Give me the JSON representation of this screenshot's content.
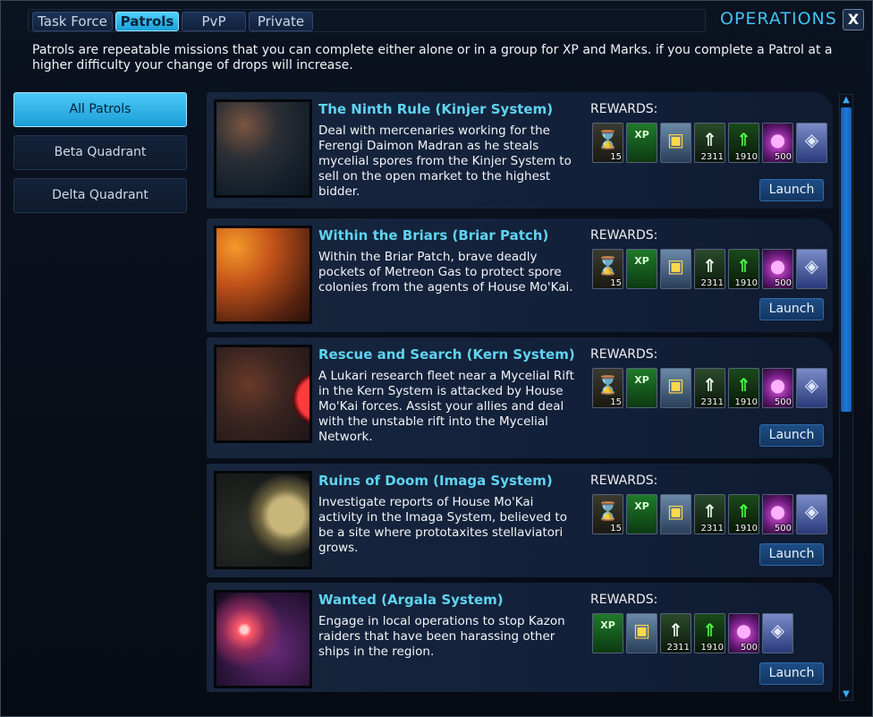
{
  "tabs": [
    "Task Force",
    "Patrols",
    "PvP",
    "Private"
  ],
  "active_tab": "Patrols",
  "window_title": "OPERATIONS",
  "close_label": "X",
  "intro": "Patrols are repeatable missions that you can complete either alone or in a group for XP and Marks. if you complete a Patrol at a higher difficulty your change of drops will increase.",
  "sidebar": {
    "items": [
      {
        "label": "All Patrols",
        "active": true
      },
      {
        "label": "Beta Quadrant",
        "active": false
      },
      {
        "label": "Delta Quadrant",
        "active": false
      }
    ]
  },
  "missions": [
    {
      "title": "The Ninth Rule (Kinjer System)",
      "description": "Deal with mercenaries working for the Ferengi Daimon Madran as he steals mycelial spores from the Kinjer System to sell on the open market to the highest bidder.",
      "rewards_label": "REWARDS:",
      "launch_label": "Launch",
      "rewards": [
        {
          "icon": "hourglass-icon",
          "qty": "15"
        },
        {
          "icon": "xp-2x-icon",
          "qty": ""
        },
        {
          "icon": "lockbox-icon",
          "qty": ""
        },
        {
          "icon": "chevron-up-white-icon",
          "qty": "2311"
        },
        {
          "icon": "chevron-up-green-icon",
          "qty": "1910"
        },
        {
          "icon": "mycelial-pod-icon",
          "qty": "500"
        },
        {
          "icon": "crate-icon",
          "qty": ""
        }
      ]
    },
    {
      "title": "Within the Briars (Briar Patch)",
      "description": "Within the Briar Patch, brave deadly pockets of Metreon Gas to protect spore colonies from the agents of House Mo'Kai.",
      "rewards_label": "REWARDS:",
      "launch_label": "Launch",
      "rewards": [
        {
          "icon": "hourglass-icon",
          "qty": "15"
        },
        {
          "icon": "xp-2x-icon",
          "qty": ""
        },
        {
          "icon": "lockbox-icon",
          "qty": ""
        },
        {
          "icon": "chevron-up-white-icon",
          "qty": "2311"
        },
        {
          "icon": "chevron-up-green-icon",
          "qty": "1910"
        },
        {
          "icon": "mycelial-pod-icon",
          "qty": "500"
        },
        {
          "icon": "crate-icon",
          "qty": ""
        }
      ]
    },
    {
      "title": "Rescue and Search (Kern System)",
      "description": "A Lukari research fleet near a Mycelial Rift in the Kern System is attacked by House Mo'Kai forces. Assist your allies and deal with the unstable rift into the Mycelial Network.",
      "rewards_label": "REWARDS:",
      "launch_label": "Launch",
      "rewards": [
        {
          "icon": "hourglass-icon",
          "qty": "15"
        },
        {
          "icon": "xp-2x-icon",
          "qty": ""
        },
        {
          "icon": "lockbox-icon",
          "qty": ""
        },
        {
          "icon": "chevron-up-white-icon",
          "qty": "2311"
        },
        {
          "icon": "chevron-up-green-icon",
          "qty": "1910"
        },
        {
          "icon": "mycelial-pod-icon",
          "qty": "500"
        },
        {
          "icon": "crate-icon",
          "qty": ""
        }
      ]
    },
    {
      "title": "Ruins of Doom (Imaga System)",
      "description": "Investigate reports of House Mo'Kai activity in the Imaga System, believed to be a site where prototaxites stellaviatori grows.",
      "rewards_label": "REWARDS:",
      "launch_label": "Launch",
      "rewards": [
        {
          "icon": "hourglass-icon",
          "qty": "15"
        },
        {
          "icon": "xp-2x-icon",
          "qty": ""
        },
        {
          "icon": "lockbox-icon",
          "qty": ""
        },
        {
          "icon": "chevron-up-white-icon",
          "qty": "2311"
        },
        {
          "icon": "chevron-up-green-icon",
          "qty": "1910"
        },
        {
          "icon": "mycelial-pod-icon",
          "qty": "500"
        },
        {
          "icon": "crate-icon",
          "qty": ""
        }
      ]
    },
    {
      "title": "Wanted (Argala System)",
      "description": "Engage in local operations to stop Kazon raiders that have been harassing other ships in the region.",
      "rewards_label": "REWARDS:",
      "launch_label": "Launch",
      "rewards": [
        {
          "icon": "xp-2x-icon",
          "qty": ""
        },
        {
          "icon": "lockbox-icon",
          "qty": ""
        },
        {
          "icon": "chevron-up-white-icon",
          "qty": "2311"
        },
        {
          "icon": "chevron-up-green-icon",
          "qty": "1910"
        },
        {
          "icon": "mycelial-pod-icon",
          "qty": "500"
        },
        {
          "icon": "crate-icon",
          "qty": ""
        }
      ]
    }
  ],
  "colors": {
    "accent": "#3fc3f0",
    "title": "#5fd4f0",
    "launch": "#1d4d86"
  }
}
